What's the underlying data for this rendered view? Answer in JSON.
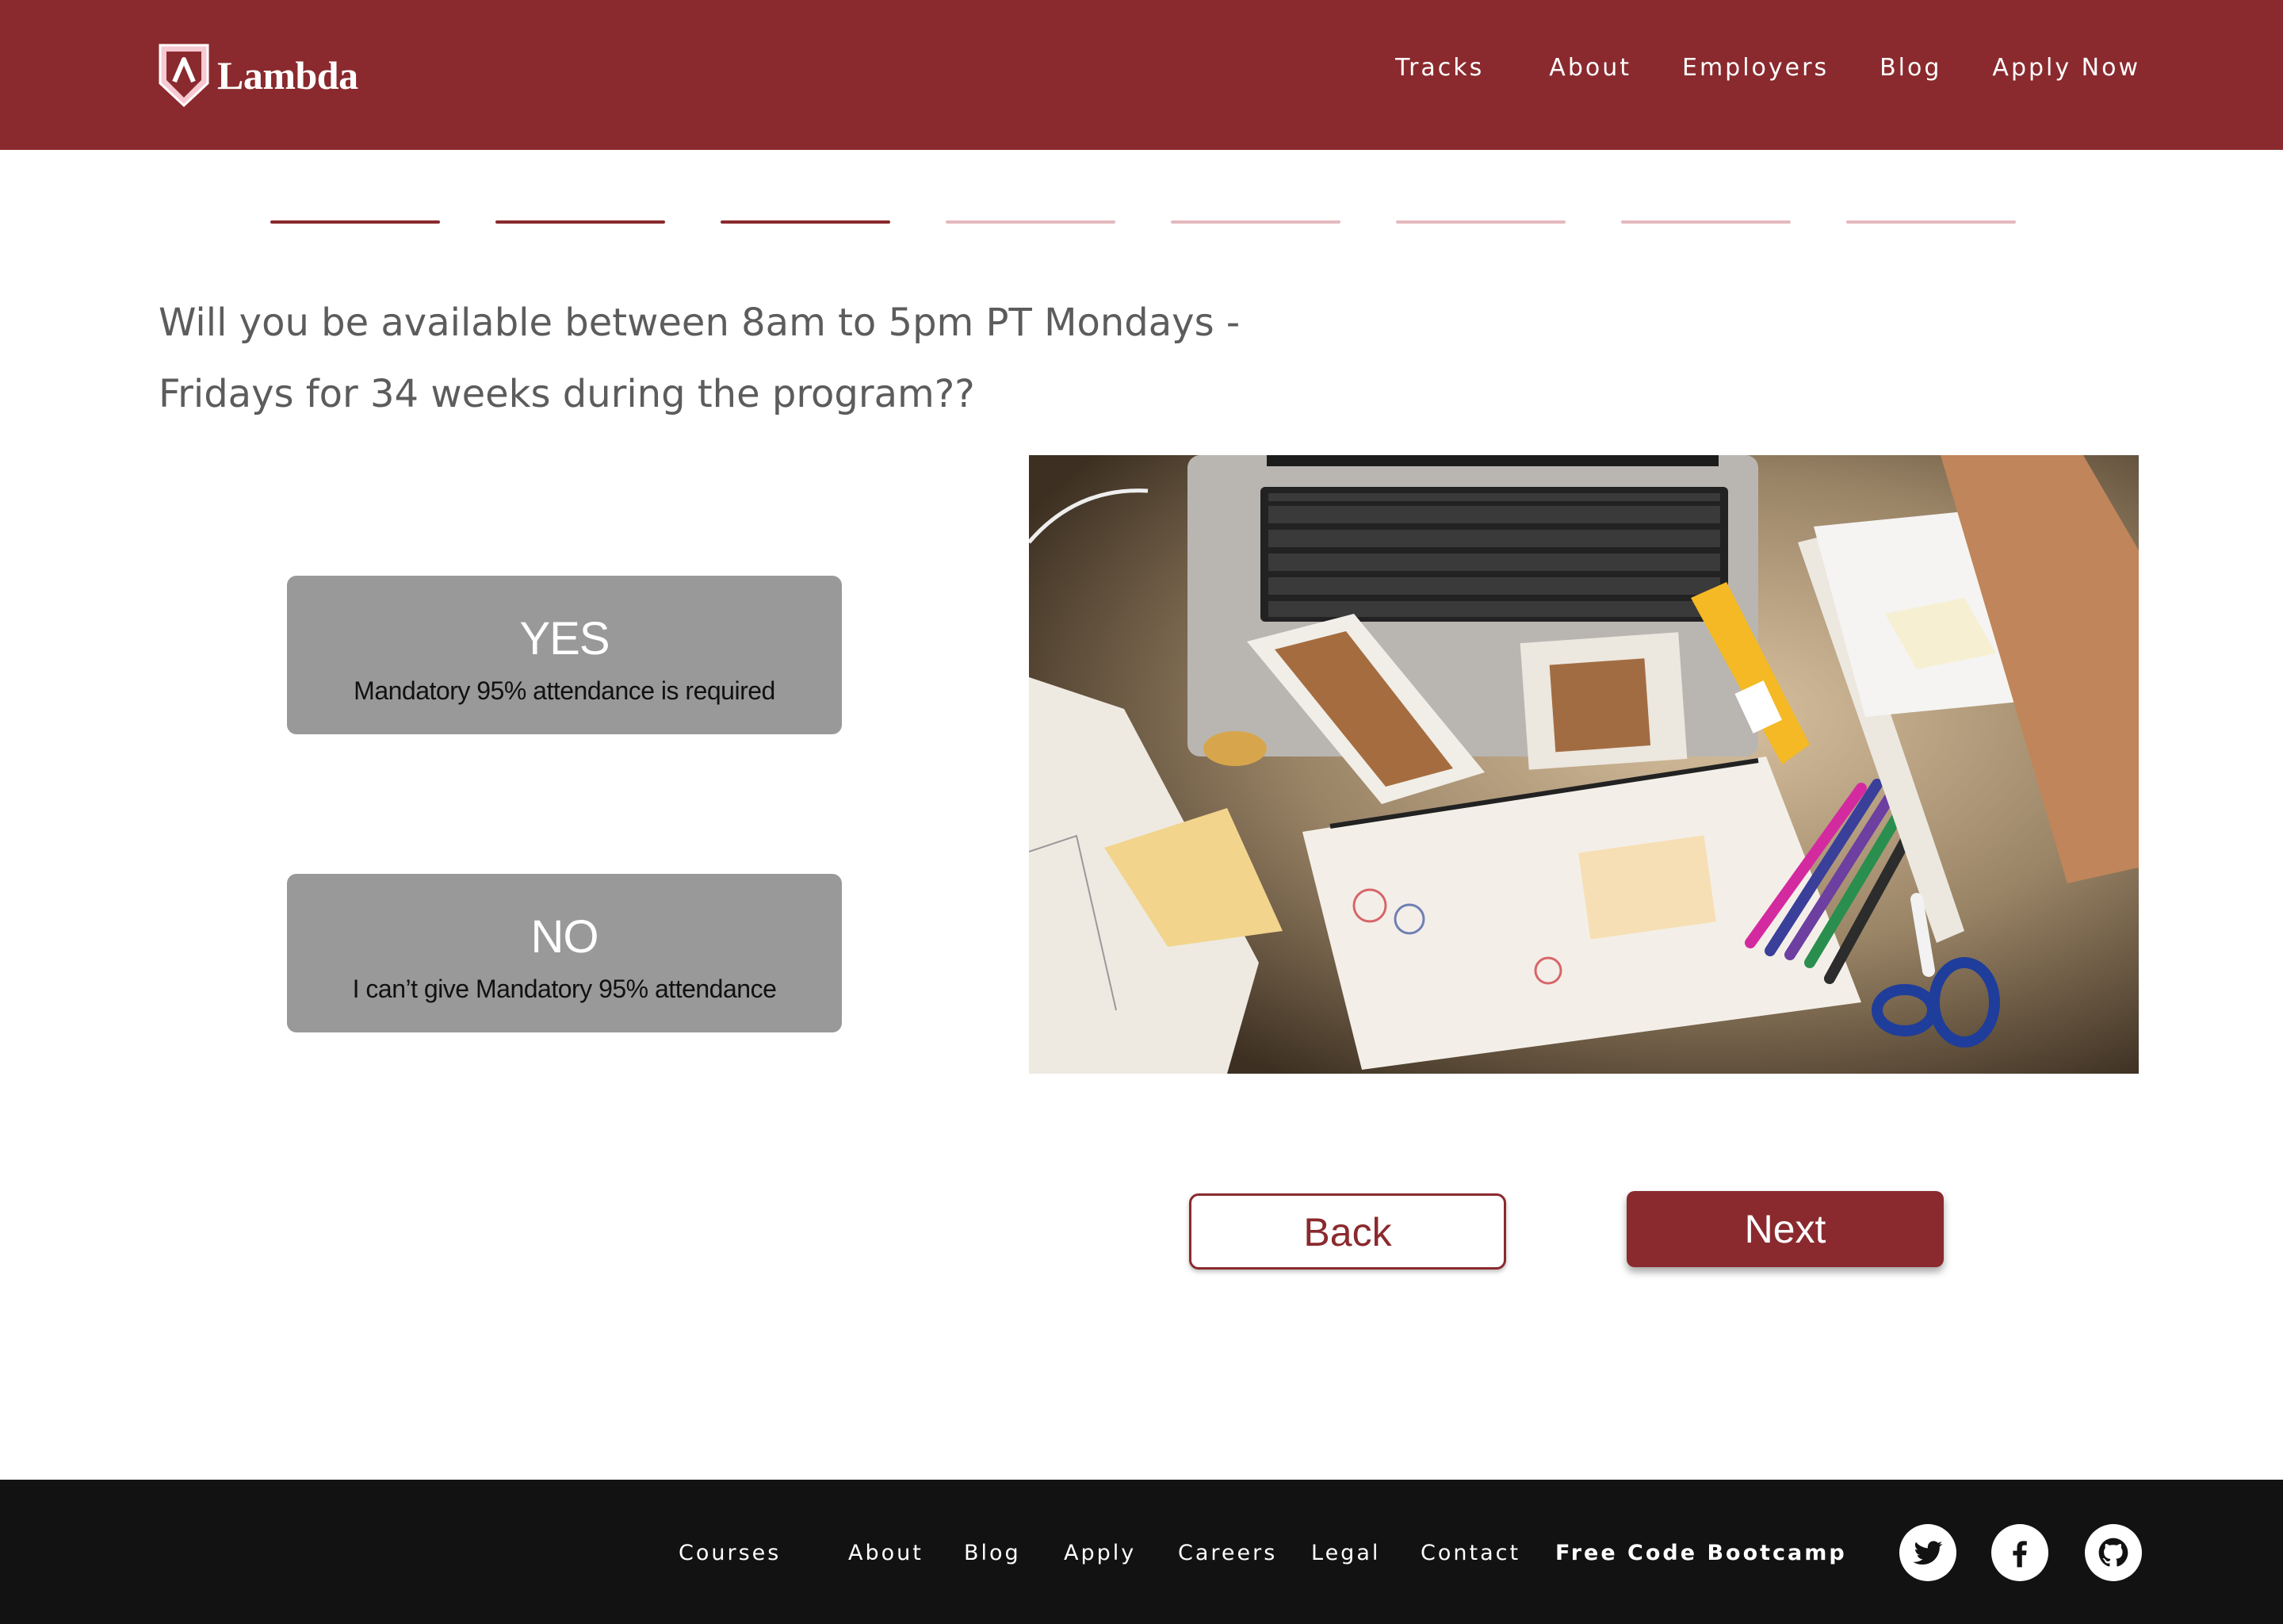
{
  "brand": {
    "name": "Lambda"
  },
  "nav": {
    "items": [
      {
        "label": "Tracks"
      },
      {
        "label": "About"
      },
      {
        "label": "Employers"
      },
      {
        "label": "Blog"
      },
      {
        "label": "Apply Now"
      }
    ]
  },
  "progress": {
    "total_steps": 8,
    "completed_steps": 3
  },
  "question": {
    "line1": "Will you be available between 8am to 5pm PT Mondays -",
    "line2": "Fridays for 34 weeks during the program??"
  },
  "answers": [
    {
      "title": "YES",
      "subtitle": "Mandatory 95% attendance is required"
    },
    {
      "title": "NO",
      "subtitle": "I can’t give Mandatory 95% attendance"
    }
  ],
  "buttons": {
    "back": "Back",
    "next": "Next"
  },
  "footer": {
    "links": [
      {
        "label": "Courses"
      },
      {
        "label": "About"
      },
      {
        "label": "Blog"
      },
      {
        "label": "Apply"
      },
      {
        "label": "Careers"
      },
      {
        "label": "Legal"
      },
      {
        "label": "Contact"
      },
      {
        "label": "Free Code Bootcamp"
      }
    ],
    "social": [
      "twitter-icon",
      "facebook-icon",
      "github-icon"
    ]
  },
  "colors": {
    "brand": "#8a2a2e",
    "progress_inactive": "#e4b9be",
    "answer_bg": "#999999",
    "footer_bg": "#121212"
  }
}
